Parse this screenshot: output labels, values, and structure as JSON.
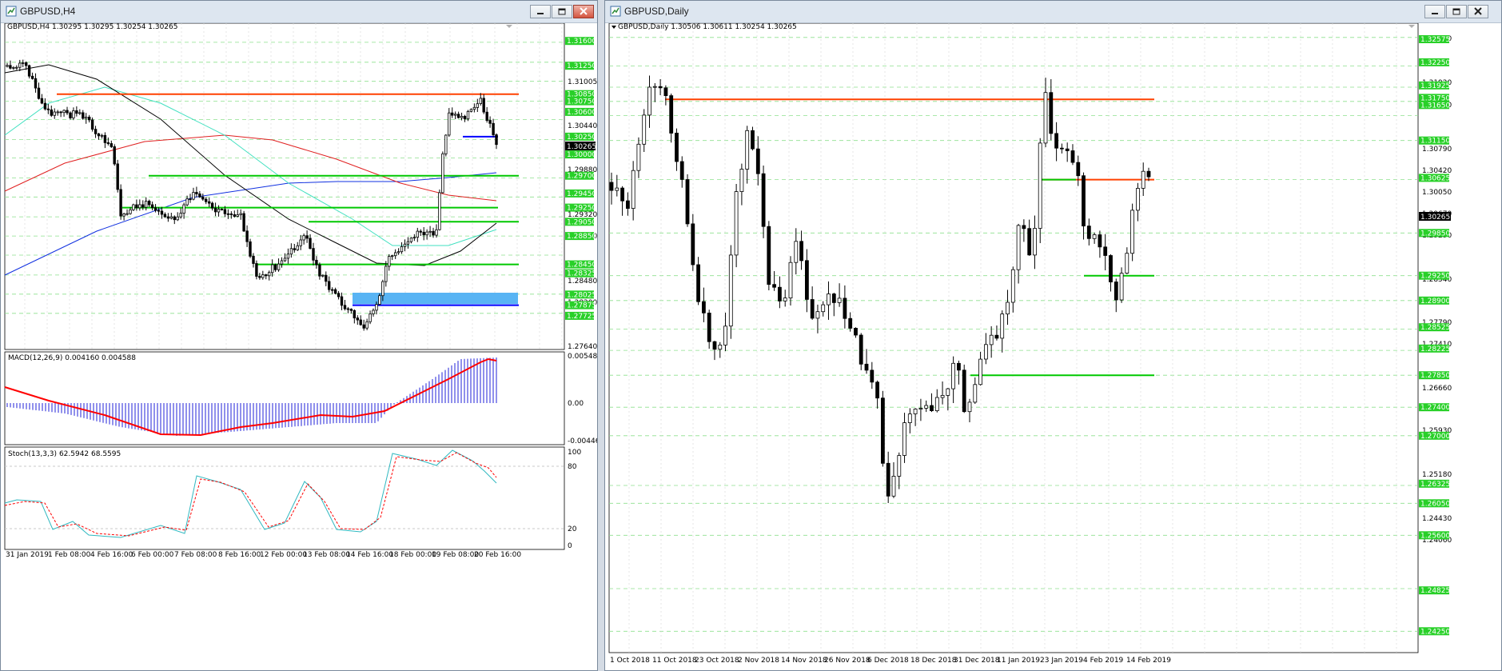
{
  "left_window": {
    "title": "GBPUSD,H4"
  },
  "right_window": {
    "title": "GBPUSD,Daily"
  },
  "chart_data": [
    {
      "type": "candlestick",
      "title": "GBPUSD,H4",
      "header": "GBPUSD,H4  1.30295 1.30295 1.30254 1.30265",
      "ylim": [
        1.2725,
        1.3185
      ],
      "yticks": [
        "1.31005",
        "1.30440",
        "1.29880",
        "1.29320",
        "1.29040",
        "1.28480",
        "1.28200",
        "1.27640"
      ],
      "level_labels": [
        "1.31600",
        "1.31250",
        "1.30850",
        "1.30750",
        "1.30600",
        "1.30250",
        "1.30000",
        "1.29700",
        "1.29450",
        "1.29250",
        "1.29050",
        "1.28850",
        "1.28450",
        "1.28325",
        "1.28025",
        "1.27875",
        "1.27725"
      ],
      "current_price": "1.30265",
      "xtick_labels": [
        "31 Jan 2019",
        "1 Feb 08:00",
        "4 Feb 16:00",
        "6 Feb 00:00",
        "7 Feb 08:00",
        "8 Feb 16:00",
        "12 Feb 00:00",
        "13 Feb 08:00",
        "14 Feb 16:00",
        "18 Feb 00:00",
        "19 Feb 08:00",
        "20 Feb 16:00"
      ],
      "indicators": [
        {
          "name": "MACD(12,26,9)",
          "values": "0.004160 0.004588",
          "yticks": [
            "0.005482",
            "0.00",
            "-0.004467"
          ]
        },
        {
          "name": "Stoch(13,3,3)",
          "values": "62.5942 68.5595",
          "yticks": [
            "100",
            "80",
            "20",
            "0"
          ]
        }
      ],
      "colors": {
        "resistance": "#ff4000",
        "support": "#00c800",
        "current_level": "#0000ff",
        "zone": "#58b4f4",
        "ma_fast": "#000000",
        "ma_mid": "#40e0c0",
        "ma_slow": "#e02020",
        "ma_long": "#1030e0",
        "macd_hist": "#2020d8",
        "macd_signal": "#ff0000",
        "stoch_main": "#30b8c0",
        "stoch_signal": "#ff0000"
      }
    },
    {
      "type": "candlestick",
      "title": "GBPUSD,Daily",
      "header": "GBPUSD,Daily  1.30506 1.30611 1.30254 1.30265",
      "ylim": [
        1.2395,
        1.328
      ],
      "yticks": [
        "1.32670",
        "1.31920",
        "1.31540",
        "1.30790",
        "1.30420",
        "1.30050",
        "1.29670",
        "1.29290",
        "1.28540",
        "1.27790",
        "1.27410",
        "1.26660",
        "1.25930",
        "1.25180",
        "1.24430",
        "1.24060"
      ],
      "level_labels": [
        "1.32575",
        "1.32250",
        "1.31925",
        "1.31750",
        "1.31650",
        "1.31150",
        "1.30625",
        "1.29850",
        "1.29250",
        "1.28900",
        "1.28525",
        "1.28225",
        "1.27850",
        "1.27400",
        "1.27000",
        "1.26325",
        "1.26050",
        "1.25600",
        "1.24825",
        "1.24250"
      ],
      "current_price": "1.30265",
      "xtick_labels": [
        "1 Oct 2018",
        "11 Oct 2018",
        "23 Oct 2018",
        "2 Nov 2018",
        "14 Nov 2018",
        "26 Nov 2018",
        "6 Dec 2018",
        "18 Dec 2018",
        "31 Dec 2018",
        "11 Jan 2019",
        "23 Jan 2019",
        "4 Feb 2019",
        "14 Feb 2019"
      ],
      "colors": {
        "resistance": "#ff4000",
        "support": "#00c800"
      }
    }
  ]
}
